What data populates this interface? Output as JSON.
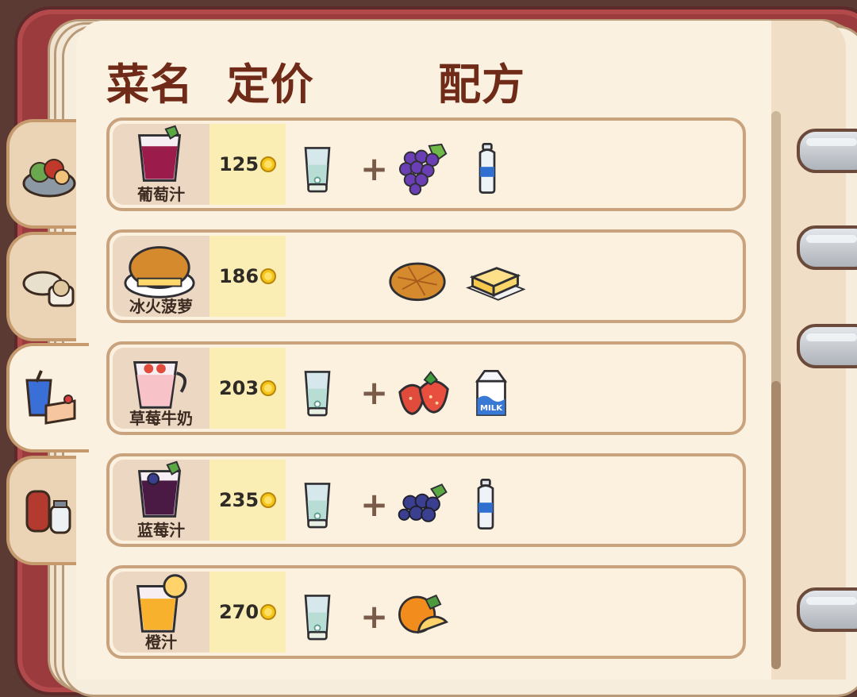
{
  "header": {
    "name_label": "菜名",
    "price_label": "定价",
    "recipe_label": "配方"
  },
  "side_tabs": [
    {
      "icon": "salad-bowl-icon"
    },
    {
      "icon": "dumpling-bowl-icon"
    },
    {
      "icon": "drink-and-cake-icon",
      "active": true
    },
    {
      "icon": "condiment-bottles-icon"
    }
  ],
  "recipes": [
    {
      "name": "葡萄汁",
      "price": "125",
      "dish_icon": "grape-juice-icon",
      "ingredients": [
        "blender-icon",
        "plus",
        "grape-icon",
        "water-bottle-icon"
      ]
    },
    {
      "name": "冰火菠萝",
      "price": "186",
      "dish_icon": "pineapple-bun-icon",
      "ingredients": [
        "pineapple-bun-icon",
        "butter-icon"
      ]
    },
    {
      "name": "草莓牛奶",
      "price": "203",
      "dish_icon": "strawberry-milk-icon",
      "ingredients": [
        "blender-icon",
        "plus",
        "strawberry-icon",
        "milk-carton-icon"
      ]
    },
    {
      "name": "蓝莓汁",
      "price": "235",
      "dish_icon": "blueberry-juice-icon",
      "ingredients": [
        "blender-icon",
        "plus",
        "blueberry-icon",
        "water-bottle-icon"
      ]
    },
    {
      "name": "橙汁",
      "price": "270",
      "dish_icon": "orange-juice-icon",
      "ingredients": [
        "blender-icon",
        "plus",
        "orange-icon"
      ]
    }
  ],
  "milk_carton_text": "MILK",
  "colors": {
    "title": "#6f2b18",
    "price_bg": "#fbeeb5",
    "dish_bg": "#ecd7c3",
    "row_border": "#c9a27e",
    "cover": "#9b3b3d"
  }
}
